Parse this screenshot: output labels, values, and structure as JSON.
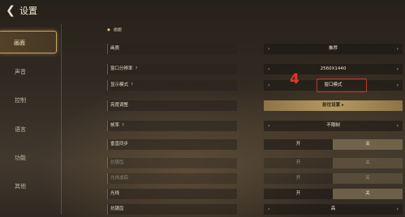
{
  "header": {
    "title": "设置",
    "back_icon": "back-arrow-icon"
  },
  "sidebar": {
    "items": [
      {
        "label": "画面",
        "active": true
      },
      {
        "label": "声音",
        "active": false
      },
      {
        "label": "控制",
        "active": false
      },
      {
        "label": "语言",
        "active": false
      },
      {
        "label": "功能",
        "active": false
      },
      {
        "label": "其他",
        "active": false
      }
    ]
  },
  "section": {
    "title": "画面"
  },
  "rows": [
    {
      "label": "画质",
      "value": "推荐",
      "type": "selector"
    },
    {
      "label": "窗口分辨率",
      "help": "?",
      "value": "2560X1440",
      "type": "selector"
    },
    {
      "label": "显示模式",
      "help": "?",
      "value": "窗口模式",
      "type": "selector"
    },
    {
      "label": "亮度调整",
      "value": "前往设置",
      "type": "button"
    },
    {
      "label": "帧率",
      "help": "?",
      "value": "不限制",
      "type": "selector"
    },
    {
      "label": "垂直同步",
      "on": "开",
      "off": "关",
      "selected": "off",
      "type": "toggle"
    },
    {
      "label": "抗锯齿",
      "on": "开",
      "off": "关",
      "selected": "off",
      "type": "toggle",
      "dim": true
    },
    {
      "label": "光线追踪",
      "on": "开",
      "off": "关",
      "selected": "off",
      "type": "toggle",
      "dim": true
    },
    {
      "label": "光线",
      "on": "开",
      "off": "关",
      "selected": "off",
      "type": "toggle"
    },
    {
      "label": "抗锯齿",
      "value": "高",
      "type": "selector"
    }
  ],
  "annotation": {
    "text": "4",
    "color": "#e0362a"
  },
  "colors": {
    "accent": "#c9a66a",
    "highlight_border": "#c03a2a"
  }
}
